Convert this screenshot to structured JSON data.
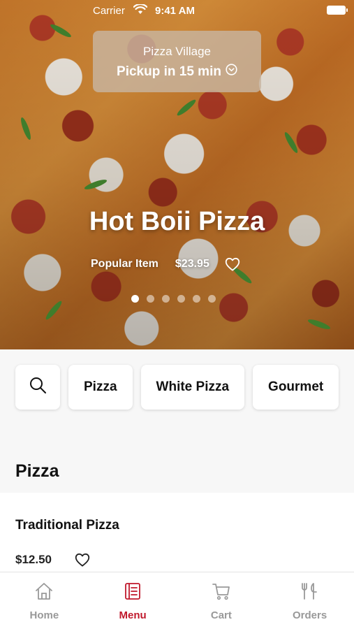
{
  "status_bar": {
    "carrier": "Carrier",
    "time": "9:41 AM"
  },
  "store": {
    "name": "Pizza Village",
    "pickup": "Pickup in 15 min"
  },
  "hero": {
    "title": "Hot Boii Pizza",
    "badge": "Popular Item",
    "price": "$23.95",
    "carousel_count": 6,
    "carousel_active": 0
  },
  "filters": {
    "chips": [
      "Pizza",
      "White Pizza",
      "Gourmet"
    ]
  },
  "section": {
    "title": "Pizza"
  },
  "item": {
    "name": "Traditional Pizza",
    "price": "$12.50"
  },
  "tabs": [
    {
      "label": "Home",
      "icon": "home-icon"
    },
    {
      "label": "Menu",
      "icon": "menu-icon"
    },
    {
      "label": "Cart",
      "icon": "cart-icon"
    },
    {
      "label": "Orders",
      "icon": "orders-icon"
    }
  ],
  "colors": {
    "accent": "#c0192c",
    "inactive_tab": "#999999"
  }
}
